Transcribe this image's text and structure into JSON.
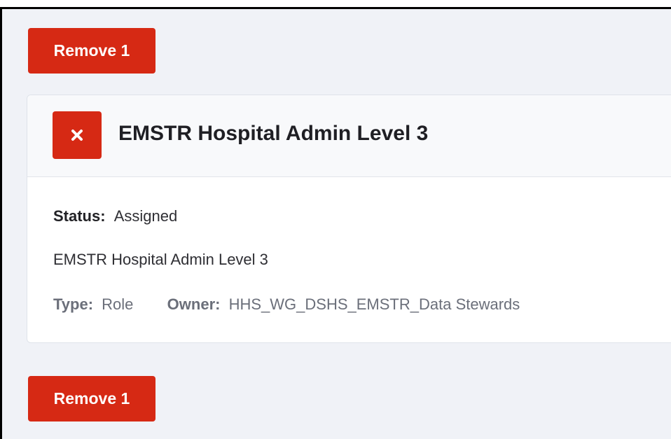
{
  "buttons": {
    "remove_top_label": "Remove 1",
    "remove_bottom_label": "Remove 1"
  },
  "card": {
    "title": "EMSTR Hospital Admin Level 3",
    "close_icon": "close-icon",
    "status_label": "Status:",
    "status_value": "Assigned",
    "description": "EMSTR Hospital Admin Level 3",
    "type_label": "Type:",
    "type_value": "Role",
    "owner_label": "Owner:",
    "owner_value": "HHS_WG_DSHS_EMSTR_Data Stewards"
  },
  "colors": {
    "accent_red": "#d62914",
    "panel_bg": "#f0f2f7",
    "card_bg": "#ffffff"
  }
}
